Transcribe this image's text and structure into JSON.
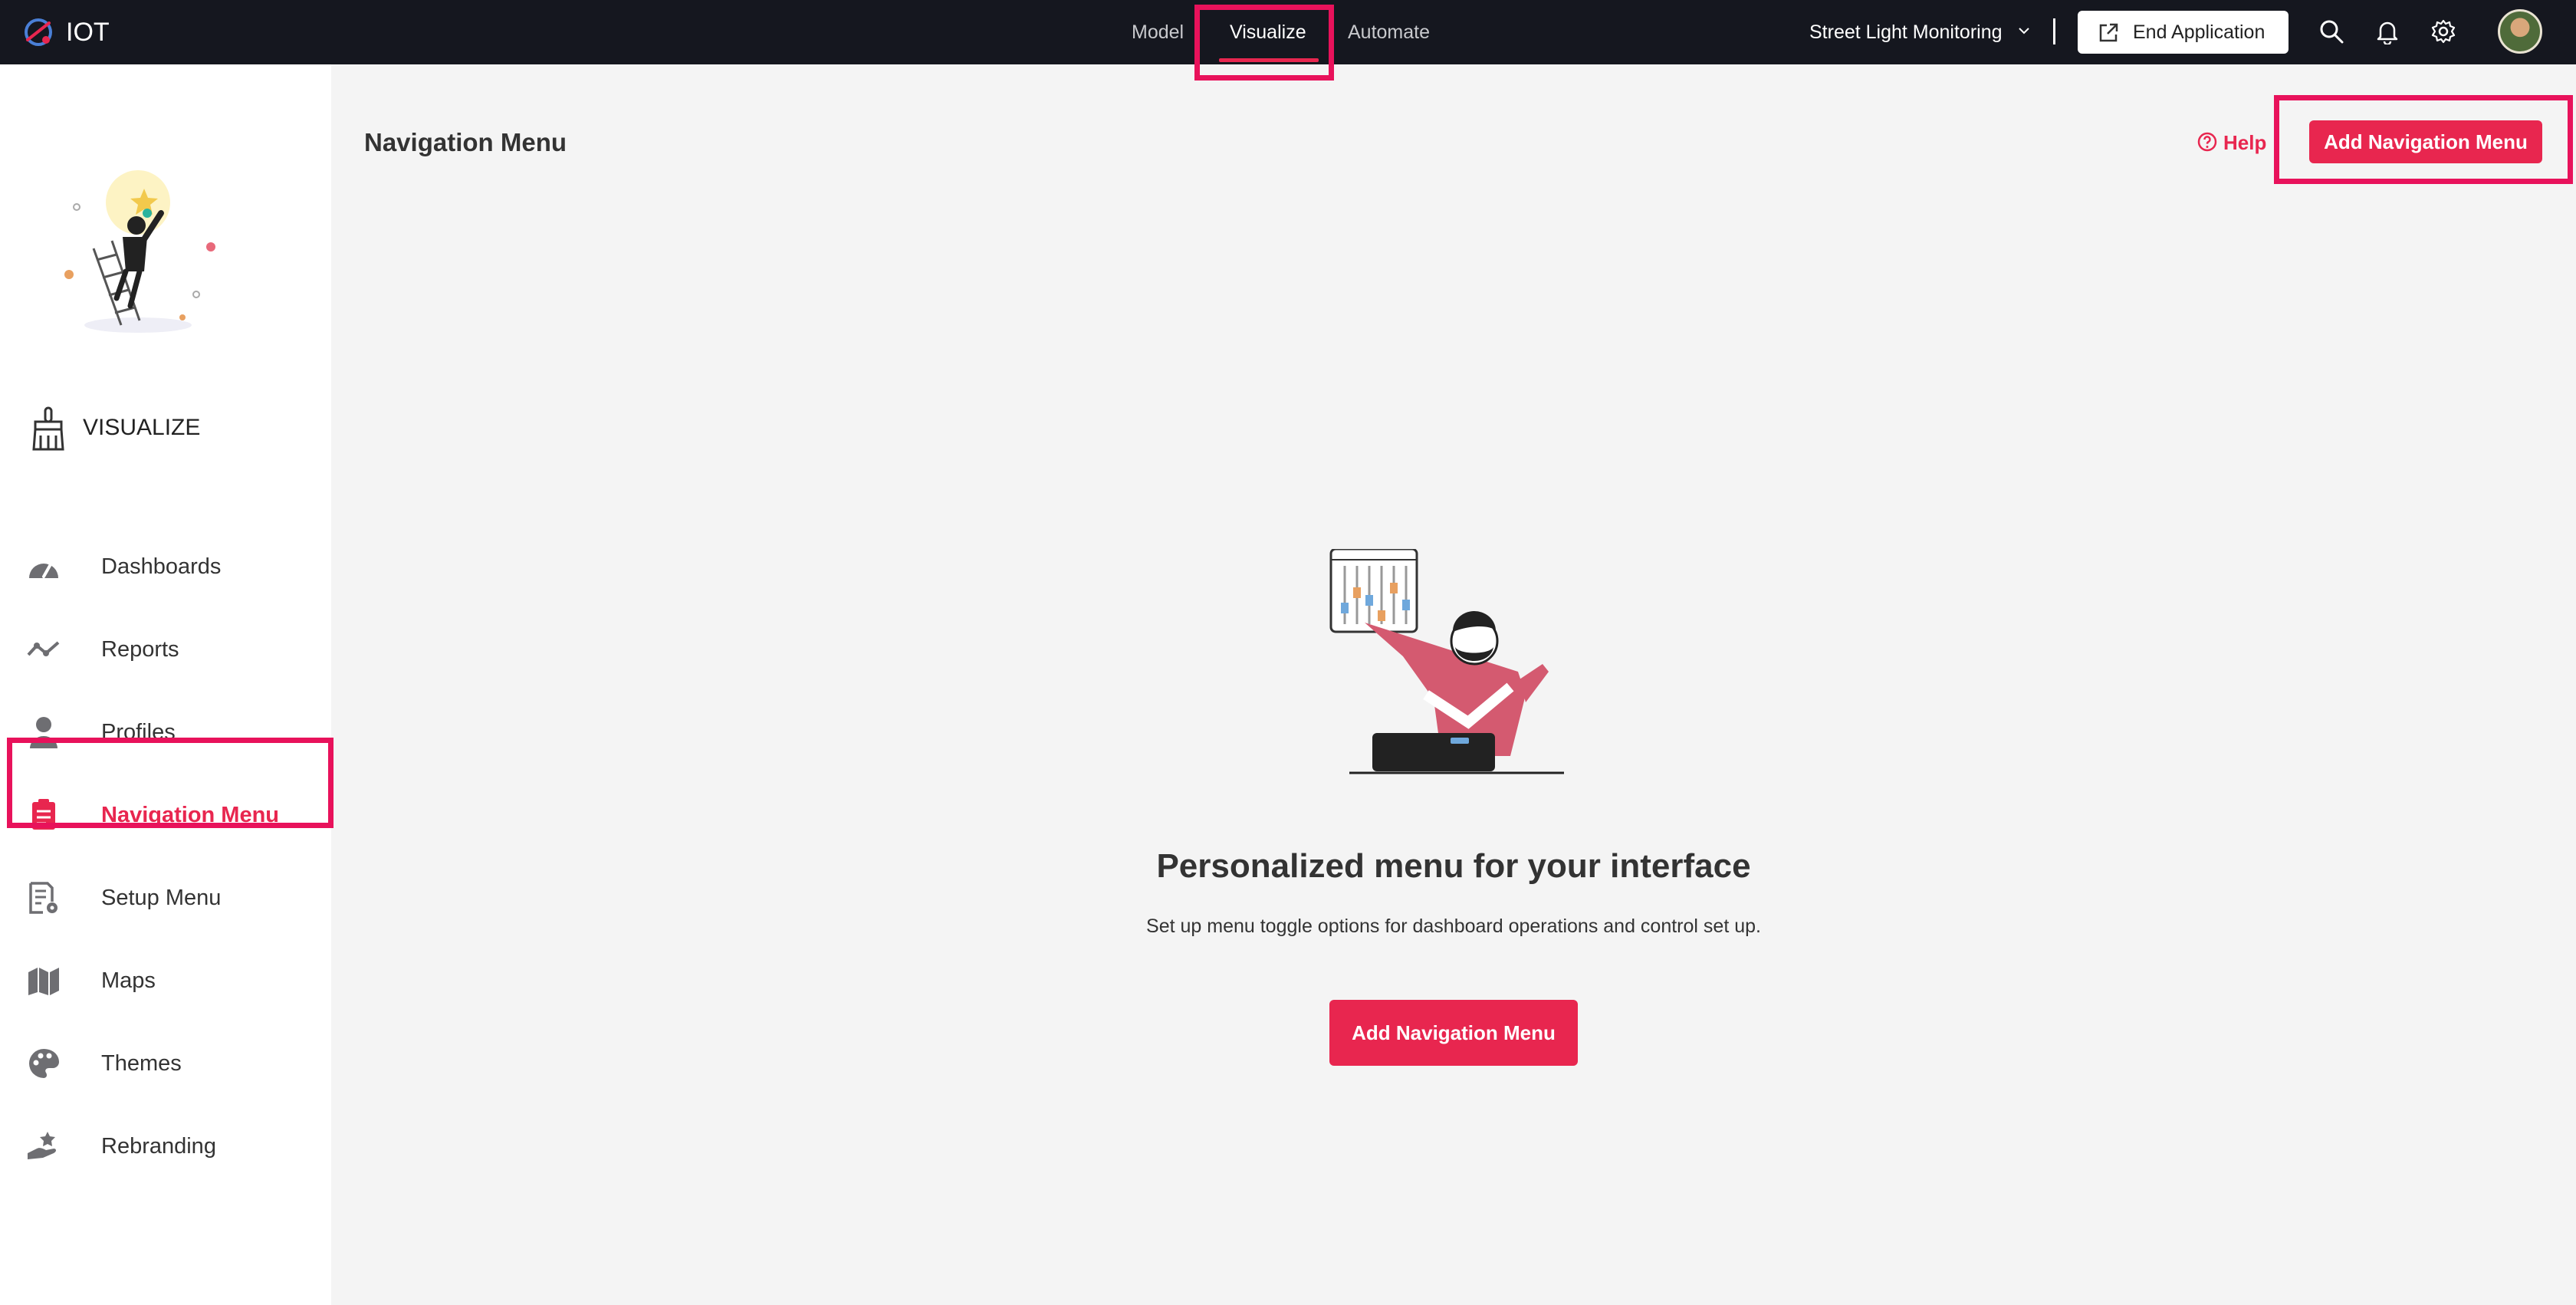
{
  "header": {
    "app_name": "IOT",
    "nav": [
      "Model",
      "Visualize",
      "Automate"
    ],
    "active_nav": "Visualize",
    "application": "Street Light Monitoring",
    "end_application": "End Application",
    "icons": [
      "search-icon",
      "bell-icon",
      "gear-icon",
      "avatar"
    ]
  },
  "sidebar": {
    "section_title": "VISUALIZE",
    "items": [
      {
        "label": "Dashboards",
        "icon": "dashboard-icon"
      },
      {
        "label": "Reports",
        "icon": "trend-line-icon"
      },
      {
        "label": "Profiles",
        "icon": "person-icon"
      },
      {
        "label": "Navigation Menu",
        "icon": "clipboard-list-icon",
        "active": true
      },
      {
        "label": "Setup Menu",
        "icon": "document-gear-icon"
      },
      {
        "label": "Maps",
        "icon": "map-icon"
      },
      {
        "label": "Themes",
        "icon": "palette-icon"
      },
      {
        "label": "Rebranding",
        "icon": "hand-star-icon"
      }
    ]
  },
  "main": {
    "title": "Navigation Menu",
    "help": "Help",
    "add_button": "Add Navigation Menu",
    "empty_title": "Personalized menu for your interface",
    "empty_desc": "Set up menu toggle options for dashboard operations and control set up.",
    "empty_button": "Add Navigation Menu"
  },
  "colors": {
    "accent": "#e8264f",
    "topbar": "#15171f",
    "highlight": "#e8125b"
  }
}
